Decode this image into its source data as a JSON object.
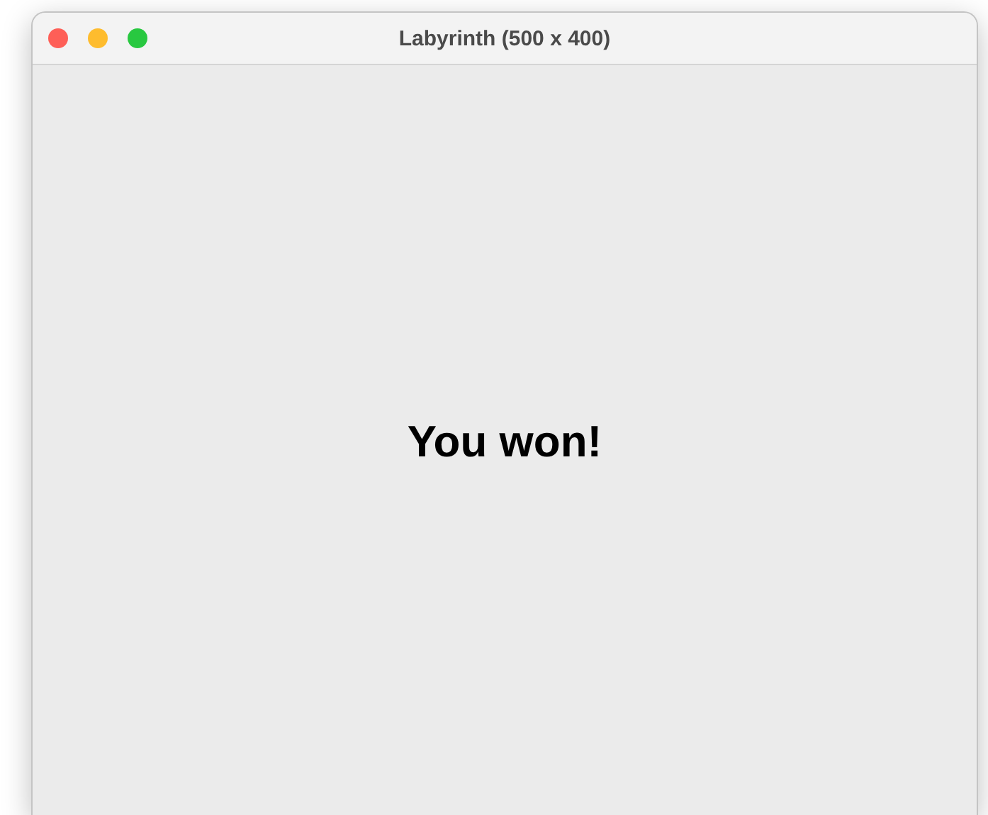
{
  "window": {
    "title": "Labyrinth (500 x 400)",
    "buttons": [
      {
        "kind": "close",
        "color": "#fe5f57"
      },
      {
        "kind": "minimize",
        "color": "#febc2e"
      },
      {
        "kind": "zoom",
        "color": "#28c840"
      }
    ]
  },
  "message": "You won!"
}
